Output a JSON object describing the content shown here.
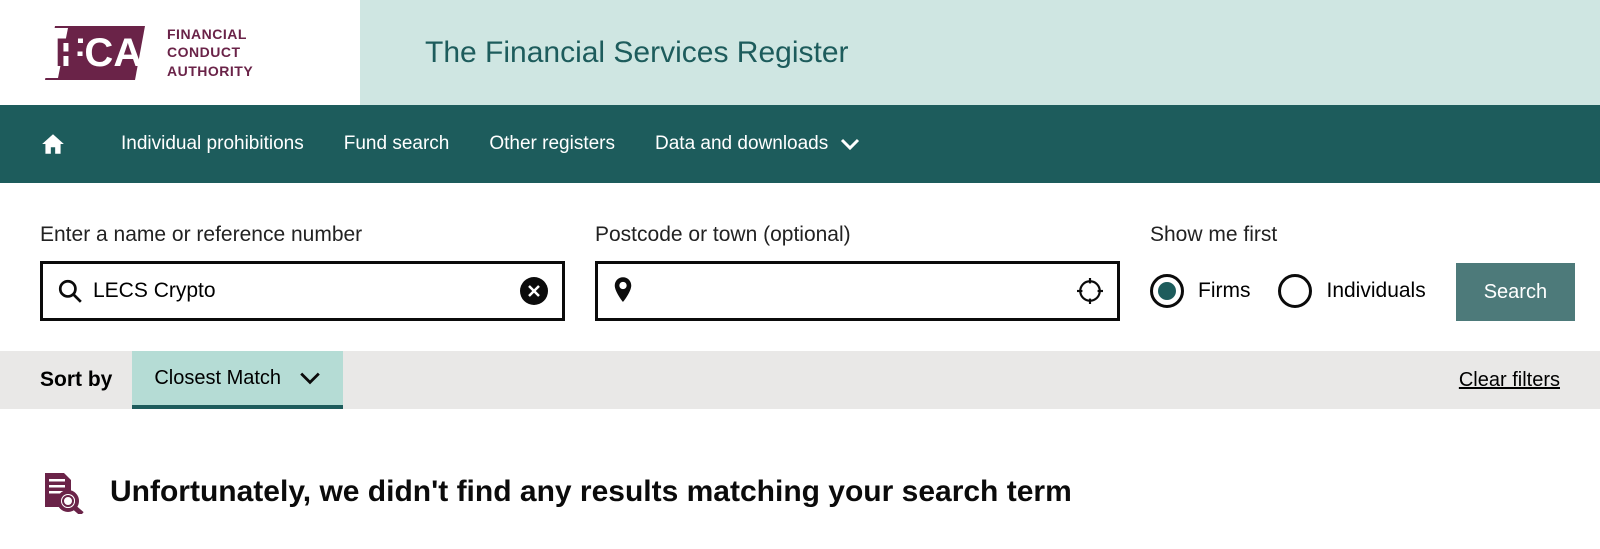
{
  "header": {
    "logo_text_lines": [
      "FINANCIAL",
      "CONDUCT",
      "AUTHORITY"
    ],
    "page_title": "The Financial Services Register"
  },
  "nav": {
    "items": [
      {
        "label": "Individual prohibitions",
        "has_dropdown": false
      },
      {
        "label": "Fund search",
        "has_dropdown": false
      },
      {
        "label": "Other registers",
        "has_dropdown": false
      },
      {
        "label": "Data and downloads",
        "has_dropdown": true
      }
    ]
  },
  "search": {
    "name_label": "Enter a name or reference number",
    "name_value": "LECS Crypto",
    "postcode_label": "Postcode or town (optional)",
    "postcode_value": "",
    "show_first_label": "Show me first",
    "radio_firms": "Firms",
    "radio_individuals": "Individuals",
    "selected_radio": "Firms",
    "search_button": "Search"
  },
  "sort": {
    "label": "Sort by",
    "selected": "Closest Match",
    "clear_filters": "Clear filters"
  },
  "results": {
    "no_results_message": "Unfortunately, we didn't find any results matching your search term"
  },
  "colors": {
    "brand_maroon": "#6a2348",
    "brand_teal": "#1d5c5c",
    "brand_teal_light": "#cfe6e2",
    "brand_teal_mid": "#b5dcd5",
    "button_teal": "#4d7a7a"
  }
}
